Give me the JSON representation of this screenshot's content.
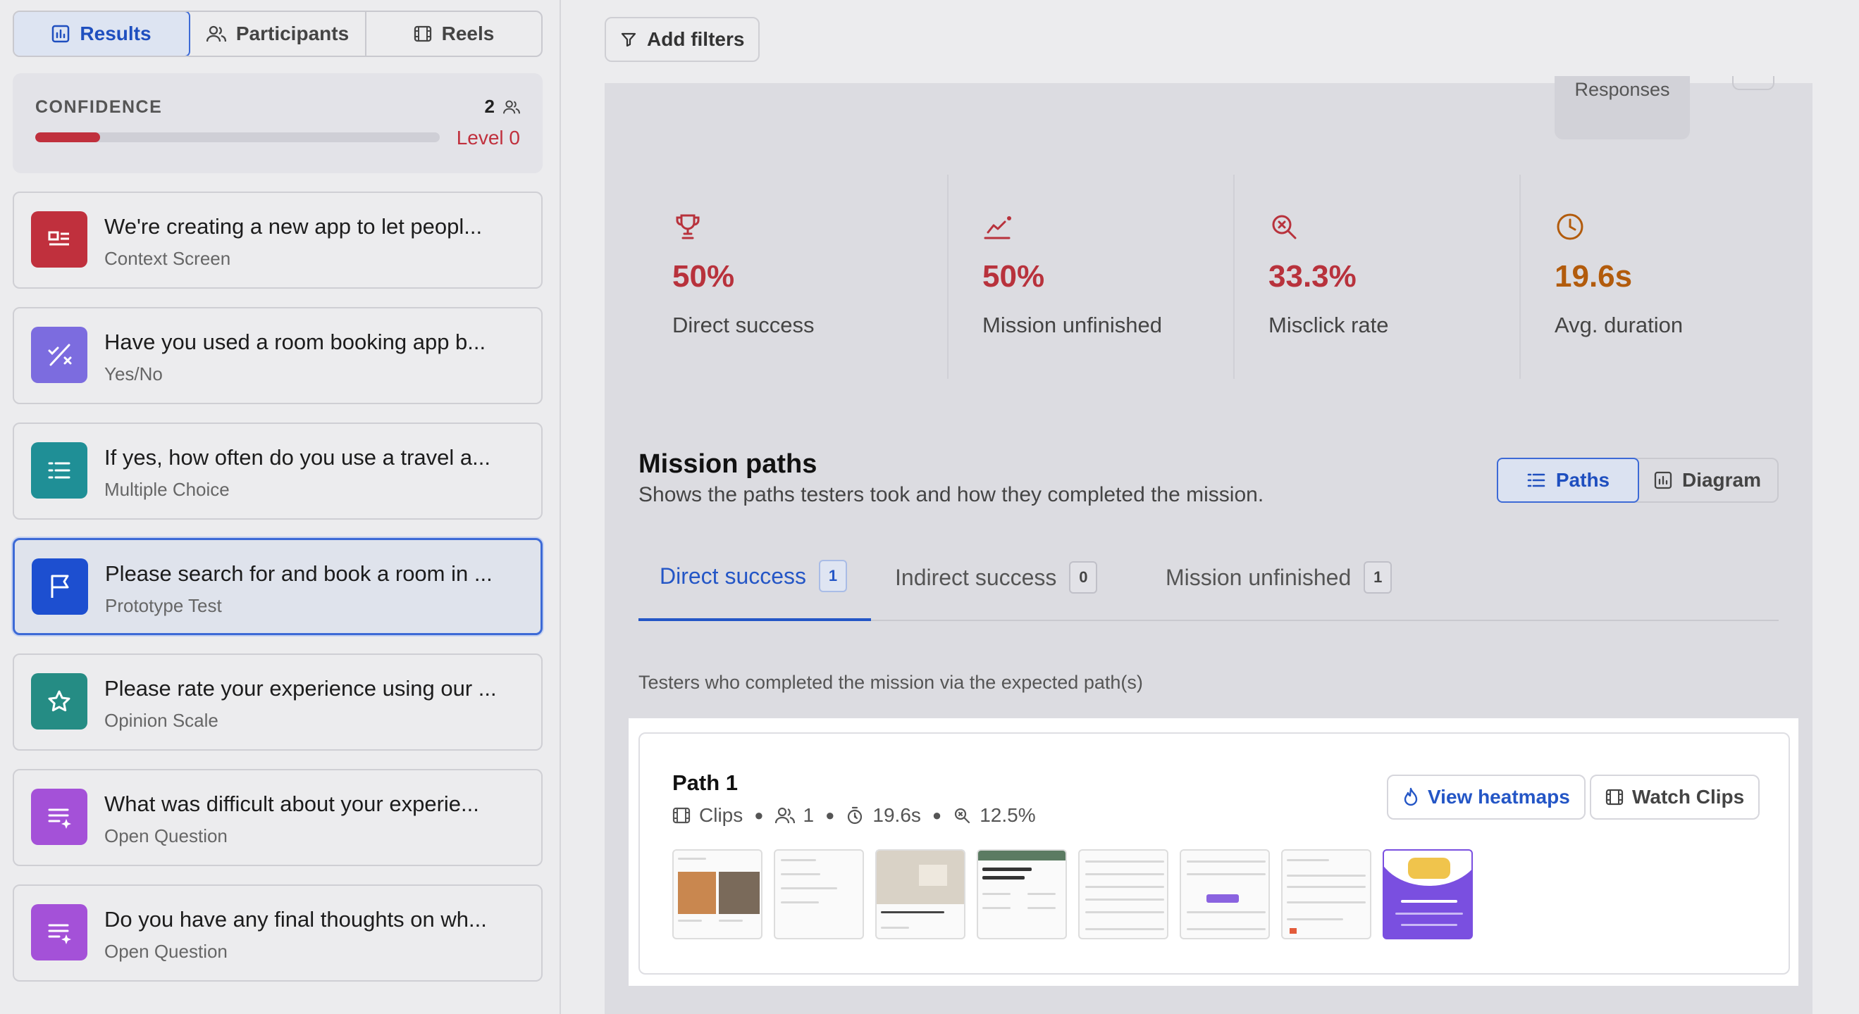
{
  "sidebar": {
    "nav": [
      {
        "label": "Results",
        "icon": "chart-icon"
      },
      {
        "label": "Participants",
        "icon": "users-icon"
      },
      {
        "label": "Reels",
        "icon": "film-icon"
      }
    ],
    "confidence": {
      "label": "CONFIDENCE",
      "count": "2",
      "level": "Level 0",
      "progress": 0.16,
      "color": "#c0303d"
    },
    "blocks": [
      {
        "title": "We're creating a new app to let peopl...",
        "type": "Context Screen",
        "icon": "context-icon",
        "color": "#c0303d"
      },
      {
        "title": "Have you used a room booking app b...",
        "type": "Yes/No",
        "icon": "yes-no-icon",
        "color": "#7c6cdf"
      },
      {
        "title": "If yes, how often do you use a travel a...",
        "type": "Multiple Choice",
        "icon": "list-icon",
        "color": "#1f8f96"
      },
      {
        "title": "Please search for and book a room in ...",
        "type": "Prototype Test",
        "icon": "flag-icon",
        "color": "#1d4fd0"
      },
      {
        "title": "Please rate your experience using our ...",
        "type": "Opinion Scale",
        "icon": "star-icon",
        "color": "#258c84"
      },
      {
        "title": "What was difficult about your experie...",
        "type": "Open Question",
        "icon": "open-text-icon",
        "color": "#a451d8"
      },
      {
        "title": "Do you have any final thoughts on wh...",
        "type": "Open Question",
        "icon": "open-text-icon",
        "color": "#a451d8"
      }
    ]
  },
  "main": {
    "add_filters": "Add filters",
    "responses_label": "Responses",
    "stats": [
      {
        "value": "50%",
        "label": "Direct success",
        "icon": "trophy-icon",
        "color": "#b8323c"
      },
      {
        "value": "50%",
        "label": "Mission unfinished",
        "icon": "give-up-icon",
        "color": "#b8323c"
      },
      {
        "value": "33.3%",
        "label": "Misclick rate",
        "icon": "misclick-icon",
        "color": "#b8323c"
      },
      {
        "value": "19.6s",
        "label": "Avg. duration",
        "icon": "clock-icon",
        "color": "#b25b0c"
      }
    ],
    "mission_paths": {
      "title": "Mission paths",
      "subtitle": "Shows the paths testers took and how they completed the mission.",
      "view_toggle": [
        "Paths",
        "Diagram"
      ],
      "tabs": [
        {
          "label": "Direct success",
          "count": "1"
        },
        {
          "label": "Indirect success",
          "count": "0"
        },
        {
          "label": "Mission unfinished",
          "count": "1"
        }
      ],
      "tab_description": "Testers who completed the mission via the expected path(s)"
    },
    "path": {
      "title": "Path 1",
      "clips_label": "Clips",
      "participants": "1",
      "duration": "19.6s",
      "misclick": "12.5%",
      "view_heatmaps": "View heatmaps",
      "watch_clips": "Watch Clips",
      "thumbnail_count": 8
    }
  }
}
